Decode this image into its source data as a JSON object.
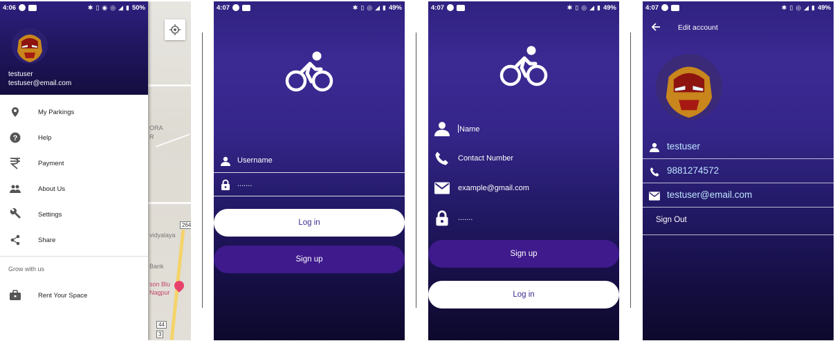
{
  "colors": {
    "primary_dark": "#1f165e",
    "accent_purple": "#3e1a8c",
    "white": "#ffffff",
    "link_blue": "#bfe4ff"
  },
  "screen1": {
    "status": {
      "time": "4:06",
      "battery": "50%"
    },
    "user": {
      "name": "testuser",
      "email": "testuser@email.com"
    },
    "menu": [
      {
        "label": "My Parkings",
        "icon": "location-pin-icon"
      },
      {
        "label": "Help",
        "icon": "help-icon"
      },
      {
        "label": "Payment",
        "icon": "rupee-icon"
      },
      {
        "label": "About Us",
        "icon": "people-icon"
      },
      {
        "label": "Settings",
        "icon": "wrench-icon"
      },
      {
        "label": "Share",
        "icon": "share-icon"
      }
    ],
    "section_title": "Grow with us",
    "section_items": [
      {
        "label": "Rent Your Space",
        "icon": "briefcase-icon"
      }
    ],
    "map_labels": {
      "a": "ORA",
      "b": "R",
      "c": "vidyalaya",
      "d": "Bank",
      "e": "son Blu",
      "f": "Nagpur",
      "g": "264",
      "h": "44",
      "i": "3"
    }
  },
  "screen2": {
    "status": {
      "time": "4:07",
      "battery": "49%"
    },
    "username_placeholder": "Username",
    "password_value": ".......",
    "login_label": "Log in",
    "signup_label": "Sign up"
  },
  "screen3": {
    "status": {
      "time": "4:07",
      "battery": "49%"
    },
    "name_placeholder": "Name",
    "contact_placeholder": "Contact Number",
    "email_placeholder": "example@gmail.com",
    "password_value": ".......",
    "signup_label": "Sign up",
    "login_label": "Log in"
  },
  "screen4": {
    "status": {
      "time": "4:07",
      "battery": "49%"
    },
    "title": "Edit account",
    "username": "testuser",
    "phone": "9881274572",
    "email": "testuser@email.com",
    "signout_label": "Sign Out"
  }
}
